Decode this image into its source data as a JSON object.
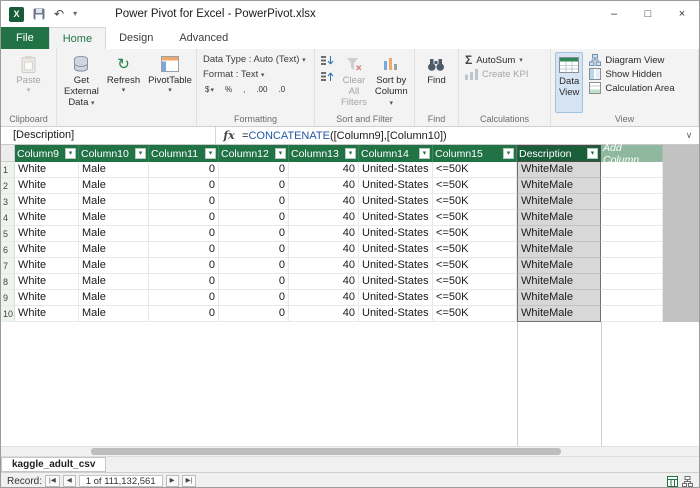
{
  "window": {
    "logo": "X",
    "undo": "↶",
    "qat_chevron": "▾",
    "title": "Power Pivot for Excel - PowerPivot.xlsx",
    "minimize": "–",
    "maximize": "□",
    "close": "×"
  },
  "tabs": {
    "file": "File",
    "home": "Home",
    "design": "Design",
    "advanced": "Advanced"
  },
  "glyphs": {
    "caret": "▾"
  },
  "ribbon": {
    "paste": "Paste",
    "get_external_1": "Get External",
    "get_external_2": "Data",
    "refresh": "Refresh",
    "pivottable": "PivotTable",
    "data_type": "Data Type : Auto (Text)",
    "format": "Format : Text",
    "fmt_currency": "$",
    "fmt_percent": "%",
    "fmt_comma": ",",
    "fmt_dec_inc": ".00",
    "fmt_dec_dec": ".0",
    "clear_filters_1": "Clear All",
    "clear_filters_2": "Filters",
    "sort_by_1": "Sort by",
    "sort_by_2": "Column",
    "find": "Find",
    "autosum_sigma": "Σ",
    "autosum": "AutoSum",
    "create_kpi": "Create KPI",
    "data_view_1": "Data",
    "data_view_2": "View",
    "diagram_view": "Diagram View",
    "show_hidden": "Show Hidden",
    "calc_area": "Calculation Area",
    "labels": {
      "clipboard": "Clipboard",
      "formatting": "Formatting",
      "sort_filter": "Sort and Filter",
      "find": "Find",
      "calculations": "Calculations",
      "view": "View"
    }
  },
  "formula_bar": {
    "name_box": "[Description]",
    "fx": "fx",
    "eq": "=",
    "fn": "CONCATENATE",
    "args": "([Column9],[Column10])",
    "expand": "∨"
  },
  "grid": {
    "columns": [
      "Column9",
      "Column10",
      "Column11",
      "Column12",
      "Column13",
      "Column14",
      "Column15",
      "Description"
    ],
    "filter_glyph": "▾",
    "add_column": "Add Column",
    "row_numbers": [
      1,
      2,
      3,
      4,
      5,
      6,
      7,
      8,
      9,
      10
    ],
    "rows": [
      [
        "White",
        "Male",
        "0",
        "0",
        "40",
        "United-States",
        "<=50K",
        "WhiteMale"
      ],
      [
        "White",
        "Male",
        "0",
        "0",
        "40",
        "United-States",
        "<=50K",
        "WhiteMale"
      ],
      [
        "White",
        "Male",
        "0",
        "0",
        "40",
        "United-States",
        "<=50K",
        "WhiteMale"
      ],
      [
        "White",
        "Male",
        "0",
        "0",
        "40",
        "United-States",
        "<=50K",
        "WhiteMale"
      ],
      [
        "White",
        "Male",
        "0",
        "0",
        "40",
        "United-States",
        "<=50K",
        "WhiteMale"
      ],
      [
        "White",
        "Male",
        "0",
        "0",
        "40",
        "United-States",
        "<=50K",
        "WhiteMale"
      ],
      [
        "White",
        "Male",
        "0",
        "0",
        "40",
        "United-States",
        "<=50K",
        "WhiteMale"
      ],
      [
        "White",
        "Male",
        "0",
        "0",
        "40",
        "United-States",
        "<=50K",
        "WhiteMale"
      ],
      [
        "White",
        "Male",
        "0",
        "0",
        "40",
        "United-States",
        "<=50K",
        "WhiteMale"
      ],
      [
        "White",
        "Male",
        "0",
        "0",
        "40",
        "United-States",
        "<=50K",
        "WhiteMale"
      ]
    ]
  },
  "sheet": {
    "tab": "kaggle_adult_csv"
  },
  "status": {
    "record_label": "Record:",
    "nav_first": "|◀",
    "nav_prev": "◀",
    "position": "1 of 111,132,561",
    "nav_next": "▶",
    "nav_last": "▶|"
  }
}
